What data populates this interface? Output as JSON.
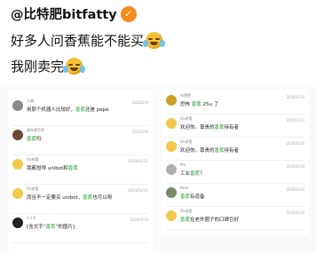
{
  "post": {
    "author": "@比特肥bitfatty",
    "lines": [
      "好多人问香蕉能不能买",
      "我刚卖完"
    ]
  },
  "colors": {
    "verified": "#f58a1f",
    "highlight": "#2a9d3a"
  },
  "icons": {
    "verified": "verified-badge-icon",
    "emoji": "crying-laughing-emoji-icon"
  },
  "left_comments": [
    {
      "user": "大猫",
      "pre": "用那个机器人比较好，",
      "hl": "香蕉",
      "post": "还是 pepe",
      "date": "2024/2/6"
    },
    {
      "user": "超年薪世界",
      "pre": "",
      "hl": "香蕉",
      "post": "吗",
      "date": "2024/2/6"
    },
    {
      "user": "Ox老管",
      "pre": "我都觉得 unibot和",
      "hl": "香蕉",
      "post": "",
      "date": "2024/01/31"
    },
    {
      "user": "Ox老管",
      "pre": "而且不一定要买 unibot，",
      "hl": "香蕉",
      "post": "也可以呀",
      "date": "2024/01/31"
    },
    {
      "user": "1.3.0",
      "pre": "[含文字“",
      "hl": "香蕉",
      "post": "”的图片]",
      "date": "2024/1/10"
    }
  ],
  "right_comments": [
    {
      "user": "布壹肥",
      "pre": "恐怖 ",
      "hl": "香蕉",
      "post": " 25u 了",
      "date": "2024/2/14"
    },
    {
      "user": "Ox老管",
      "pre": "欢迎你。尊贵的",
      "hl": "香蕉",
      "post": "持有者",
      "date": "2024/2/14"
    },
    {
      "user": "Ox老管",
      "pre": "欢迎你。尊贵的",
      "hl": "香蕉",
      "post": "持有者",
      "date": "2024/2/14"
    },
    {
      "user": "Mo",
      "pre": "工业",
      "hl": "香蕉",
      "post": "？",
      "date": "2024/2/14"
    },
    {
      "user": "Near",
      "pre": "",
      "hl": "香蕉",
      "post": "有道备",
      "date": "2024/2/14"
    },
    {
      "user": "Ox老管",
      "pre": "",
      "hl": "香蕉",
      "post": "在老外圈子的口碑巨好",
      "date": "2024/2/14"
    }
  ]
}
